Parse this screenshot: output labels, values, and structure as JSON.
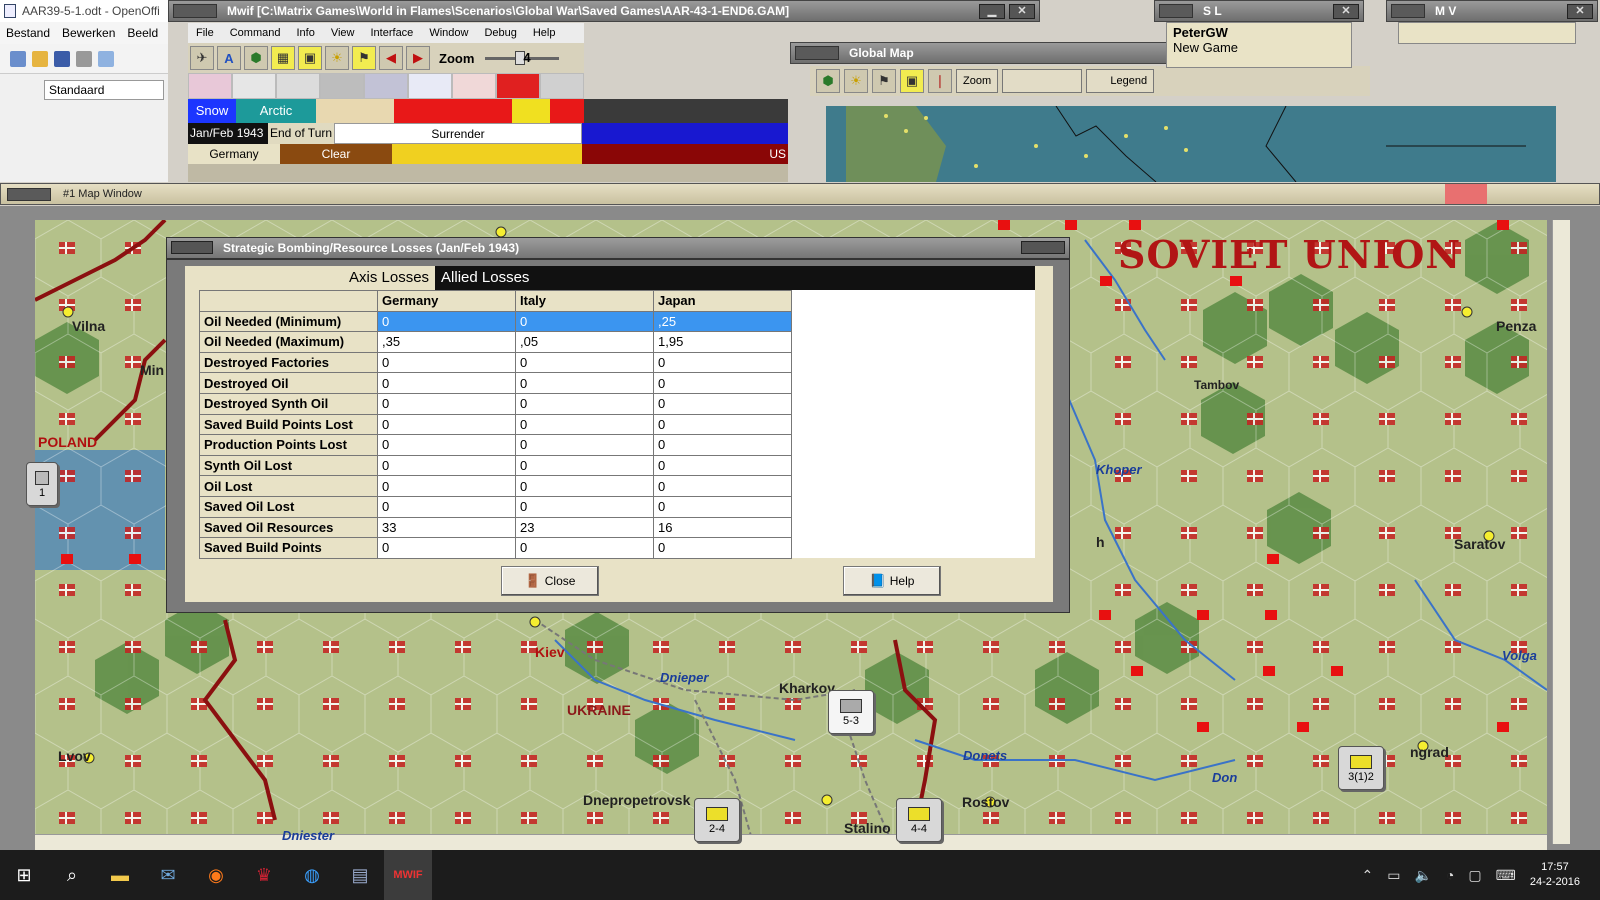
{
  "openoffice": {
    "title": "AAR39-5-1.odt - OpenOffi",
    "menu": [
      "Bestand",
      "Bewerken",
      "Beeld"
    ],
    "style_value": "Standaard"
  },
  "mwif": {
    "title": "Mwif [C:\\Matrix Games\\World in Flames\\Scenarios\\Global War\\Saved Games\\AAR-43-1-END6.GAM]",
    "menu": [
      "File",
      "Command",
      "Info",
      "View",
      "Interface",
      "Window",
      "Debug",
      "Help"
    ],
    "zoom_label": "Zoom",
    "zoom_value": "4",
    "weather": {
      "snow": "Snow",
      "arctic": "Arctic"
    },
    "turn_date": "Jan/Feb 1943",
    "turn_phase": "End of Turn",
    "surrender": "Surrender",
    "active_major": "Germany",
    "weather_state": "Clear",
    "right_label": "US"
  },
  "global_map": {
    "title": "Global Map",
    "buttons": {
      "zoom": "Zoom",
      "legend": "Legend"
    }
  },
  "sl_window": {
    "title": "S L",
    "line1": "PeterGW",
    "line2": "New Game"
  },
  "mv_window": {
    "title": "M V"
  },
  "map_window": {
    "title": "#1 Map Window",
    "country_label": "SOVIET UNION",
    "places": {
      "vilna": "Vilna",
      "minsk": "Min",
      "poland": "POLAND",
      "kiev": "Kiev",
      "ukraine": "UKRAINE",
      "dnieper": "Dnieper",
      "kharkov": "Kharkov",
      "lvov": "Lvov",
      "dniester": "Dniester",
      "dnepropetrovsk": "Dnepropetrovsk",
      "stalino": "Stalino",
      "rostov": "Rostov",
      "donets": "Donets",
      "don": "Don",
      "volga": "Volga",
      "saratov": "Saratov",
      "tambov": "Tambov",
      "khoper": "Khoper",
      "penza": "Penza",
      "stalingrad": "ngrad",
      "h": "h"
    },
    "units": {
      "soviet_corps": "5-3",
      "ger_a": "2-4",
      "ger_b": "4-4",
      "ger_c": "3(1)2",
      "left_unit": "1"
    }
  },
  "dialog": {
    "title": "Strategic Bombing/Resource Losses (Jan/Feb 1943)",
    "tabs": [
      "Axis Losses",
      "Allied Losses"
    ],
    "columns": [
      "Germany",
      "Italy",
      "Japan"
    ],
    "rows": [
      {
        "label": "Oil Needed (Minimum)",
        "values": [
          "0",
          "0",
          ",25"
        ]
      },
      {
        "label": "Oil Needed (Maximum)",
        "values": [
          ",35",
          ",05",
          "1,95"
        ]
      },
      {
        "label": "Destroyed Factories",
        "values": [
          "0",
          "0",
          "0"
        ]
      },
      {
        "label": "Destroyed Oil",
        "values": [
          "0",
          "0",
          "0"
        ]
      },
      {
        "label": "Destroyed Synth Oil",
        "values": [
          "0",
          "0",
          "0"
        ]
      },
      {
        "label": "Saved Build Points Lost",
        "values": [
          "0",
          "0",
          "0"
        ]
      },
      {
        "label": "Production Points Lost",
        "values": [
          "0",
          "0",
          "0"
        ]
      },
      {
        "label": "Synth Oil Lost",
        "values": [
          "0",
          "0",
          "0"
        ]
      },
      {
        "label": "Oil Lost",
        "values": [
          "0",
          "0",
          "0"
        ]
      },
      {
        "label": "Saved Oil Lost",
        "values": [
          "0",
          "0",
          "0"
        ]
      },
      {
        "label": "Saved Oil Resources",
        "values": [
          "33",
          "23",
          "16"
        ]
      },
      {
        "label": "Saved Build Points",
        "values": [
          "0",
          "0",
          "0"
        ]
      }
    ],
    "close_label": "Close",
    "help_label": "Help"
  },
  "taskbar": {
    "time": "17:57",
    "date": "24-2-2016"
  }
}
